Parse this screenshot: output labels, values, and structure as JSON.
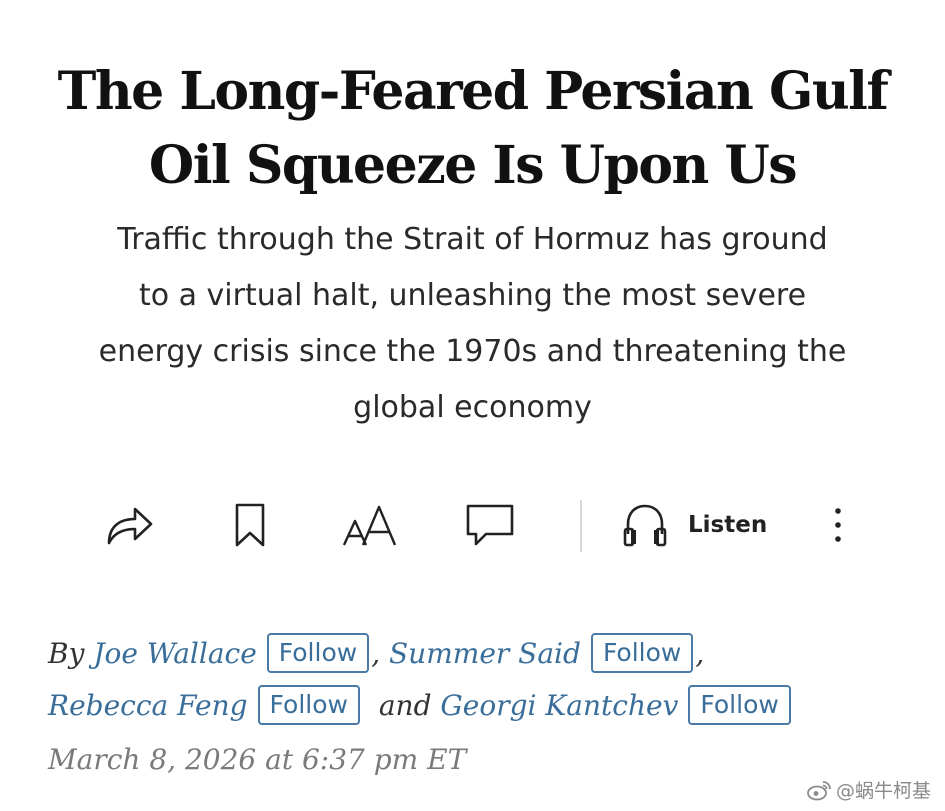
{
  "article": {
    "headline_line1": "The Long-Feared Persian Gulf",
    "headline_line2": "Oil Squeeze Is Upon Us",
    "dek_line1": "Traffic through the Strait of Hormuz has ground",
    "dek_line2": "to a virtual halt, unleashing the most severe",
    "dek_line3": "energy crisis since the 1970s and threatening the",
    "dek_line4": "global economy"
  },
  "toolbar": {
    "share_icon": "share-arrow-icon",
    "bookmark_icon": "bookmark-icon",
    "text_size_icon": "text-size-icon",
    "comment_icon": "comment-icon",
    "listen_icon": "headphones-icon",
    "listen_label": "Listen",
    "more_icon": "more-vertical-icon"
  },
  "byline": {
    "prefix": "By",
    "follow_label": "Follow",
    "authors": [
      {
        "name": "Joe Wallace"
      },
      {
        "name": "Summer Said"
      },
      {
        "name": "Rebecca Feng"
      },
      {
        "name": "Georgi Kantchev"
      }
    ],
    "separator_comma": ",",
    "conjunction": "and",
    "date": "March 8, 2026 at 6:37 pm ET"
  },
  "watermark": {
    "text": "@蜗牛柯基",
    "icon": "weibo-icon"
  },
  "colors": {
    "author_link": "#3a6e9a",
    "follow_border": "#4a7aa6",
    "date_gray": "#7a7a7a",
    "headline": "#111111"
  }
}
